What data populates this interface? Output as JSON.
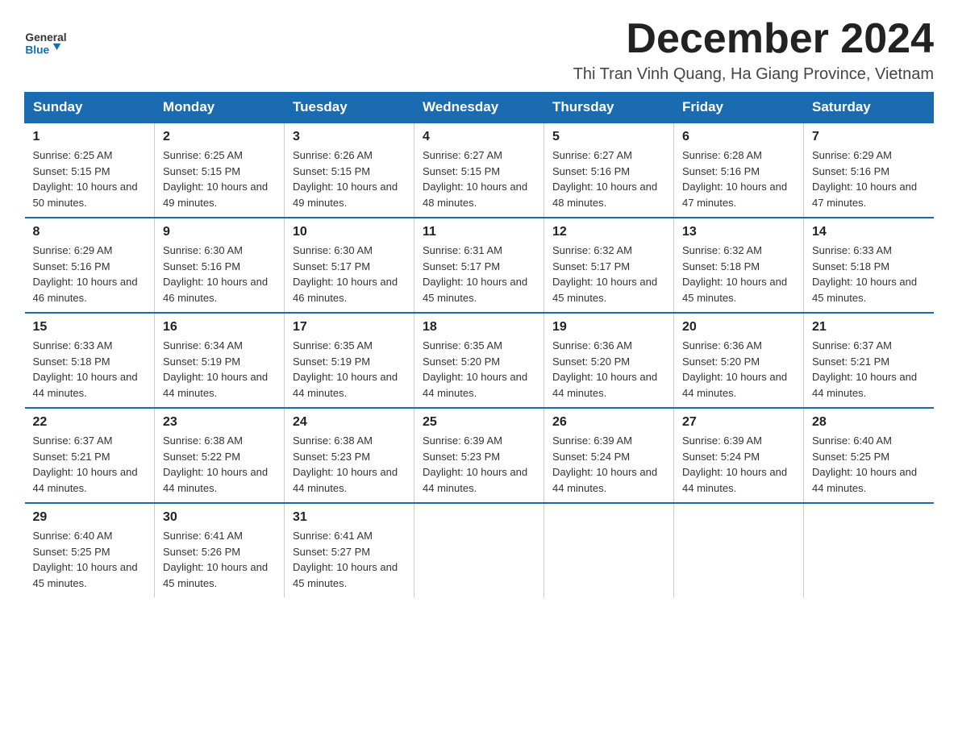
{
  "header": {
    "logo_general": "General",
    "logo_blue": "Blue",
    "month_title": "December 2024",
    "location": "Thi Tran Vinh Quang, Ha Giang Province, Vietnam"
  },
  "weekdays": [
    "Sunday",
    "Monday",
    "Tuesday",
    "Wednesday",
    "Thursday",
    "Friday",
    "Saturday"
  ],
  "weeks": [
    [
      {
        "day": "1",
        "sunrise": "6:25 AM",
        "sunset": "5:15 PM",
        "daylight": "10 hours and 50 minutes."
      },
      {
        "day": "2",
        "sunrise": "6:25 AM",
        "sunset": "5:15 PM",
        "daylight": "10 hours and 49 minutes."
      },
      {
        "day": "3",
        "sunrise": "6:26 AM",
        "sunset": "5:15 PM",
        "daylight": "10 hours and 49 minutes."
      },
      {
        "day": "4",
        "sunrise": "6:27 AM",
        "sunset": "5:15 PM",
        "daylight": "10 hours and 48 minutes."
      },
      {
        "day": "5",
        "sunrise": "6:27 AM",
        "sunset": "5:16 PM",
        "daylight": "10 hours and 48 minutes."
      },
      {
        "day": "6",
        "sunrise": "6:28 AM",
        "sunset": "5:16 PM",
        "daylight": "10 hours and 47 minutes."
      },
      {
        "day": "7",
        "sunrise": "6:29 AM",
        "sunset": "5:16 PM",
        "daylight": "10 hours and 47 minutes."
      }
    ],
    [
      {
        "day": "8",
        "sunrise": "6:29 AM",
        "sunset": "5:16 PM",
        "daylight": "10 hours and 46 minutes."
      },
      {
        "day": "9",
        "sunrise": "6:30 AM",
        "sunset": "5:16 PM",
        "daylight": "10 hours and 46 minutes."
      },
      {
        "day": "10",
        "sunrise": "6:30 AM",
        "sunset": "5:17 PM",
        "daylight": "10 hours and 46 minutes."
      },
      {
        "day": "11",
        "sunrise": "6:31 AM",
        "sunset": "5:17 PM",
        "daylight": "10 hours and 45 minutes."
      },
      {
        "day": "12",
        "sunrise": "6:32 AM",
        "sunset": "5:17 PM",
        "daylight": "10 hours and 45 minutes."
      },
      {
        "day": "13",
        "sunrise": "6:32 AM",
        "sunset": "5:18 PM",
        "daylight": "10 hours and 45 minutes."
      },
      {
        "day": "14",
        "sunrise": "6:33 AM",
        "sunset": "5:18 PM",
        "daylight": "10 hours and 45 minutes."
      }
    ],
    [
      {
        "day": "15",
        "sunrise": "6:33 AM",
        "sunset": "5:18 PM",
        "daylight": "10 hours and 44 minutes."
      },
      {
        "day": "16",
        "sunrise": "6:34 AM",
        "sunset": "5:19 PM",
        "daylight": "10 hours and 44 minutes."
      },
      {
        "day": "17",
        "sunrise": "6:35 AM",
        "sunset": "5:19 PM",
        "daylight": "10 hours and 44 minutes."
      },
      {
        "day": "18",
        "sunrise": "6:35 AM",
        "sunset": "5:20 PM",
        "daylight": "10 hours and 44 minutes."
      },
      {
        "day": "19",
        "sunrise": "6:36 AM",
        "sunset": "5:20 PM",
        "daylight": "10 hours and 44 minutes."
      },
      {
        "day": "20",
        "sunrise": "6:36 AM",
        "sunset": "5:20 PM",
        "daylight": "10 hours and 44 minutes."
      },
      {
        "day": "21",
        "sunrise": "6:37 AM",
        "sunset": "5:21 PM",
        "daylight": "10 hours and 44 minutes."
      }
    ],
    [
      {
        "day": "22",
        "sunrise": "6:37 AM",
        "sunset": "5:21 PM",
        "daylight": "10 hours and 44 minutes."
      },
      {
        "day": "23",
        "sunrise": "6:38 AM",
        "sunset": "5:22 PM",
        "daylight": "10 hours and 44 minutes."
      },
      {
        "day": "24",
        "sunrise": "6:38 AM",
        "sunset": "5:23 PM",
        "daylight": "10 hours and 44 minutes."
      },
      {
        "day": "25",
        "sunrise": "6:39 AM",
        "sunset": "5:23 PM",
        "daylight": "10 hours and 44 minutes."
      },
      {
        "day": "26",
        "sunrise": "6:39 AM",
        "sunset": "5:24 PM",
        "daylight": "10 hours and 44 minutes."
      },
      {
        "day": "27",
        "sunrise": "6:39 AM",
        "sunset": "5:24 PM",
        "daylight": "10 hours and 44 minutes."
      },
      {
        "day": "28",
        "sunrise": "6:40 AM",
        "sunset": "5:25 PM",
        "daylight": "10 hours and 44 minutes."
      }
    ],
    [
      {
        "day": "29",
        "sunrise": "6:40 AM",
        "sunset": "5:25 PM",
        "daylight": "10 hours and 45 minutes."
      },
      {
        "day": "30",
        "sunrise": "6:41 AM",
        "sunset": "5:26 PM",
        "daylight": "10 hours and 45 minutes."
      },
      {
        "day": "31",
        "sunrise": "6:41 AM",
        "sunset": "5:27 PM",
        "daylight": "10 hours and 45 minutes."
      },
      null,
      null,
      null,
      null
    ]
  ]
}
